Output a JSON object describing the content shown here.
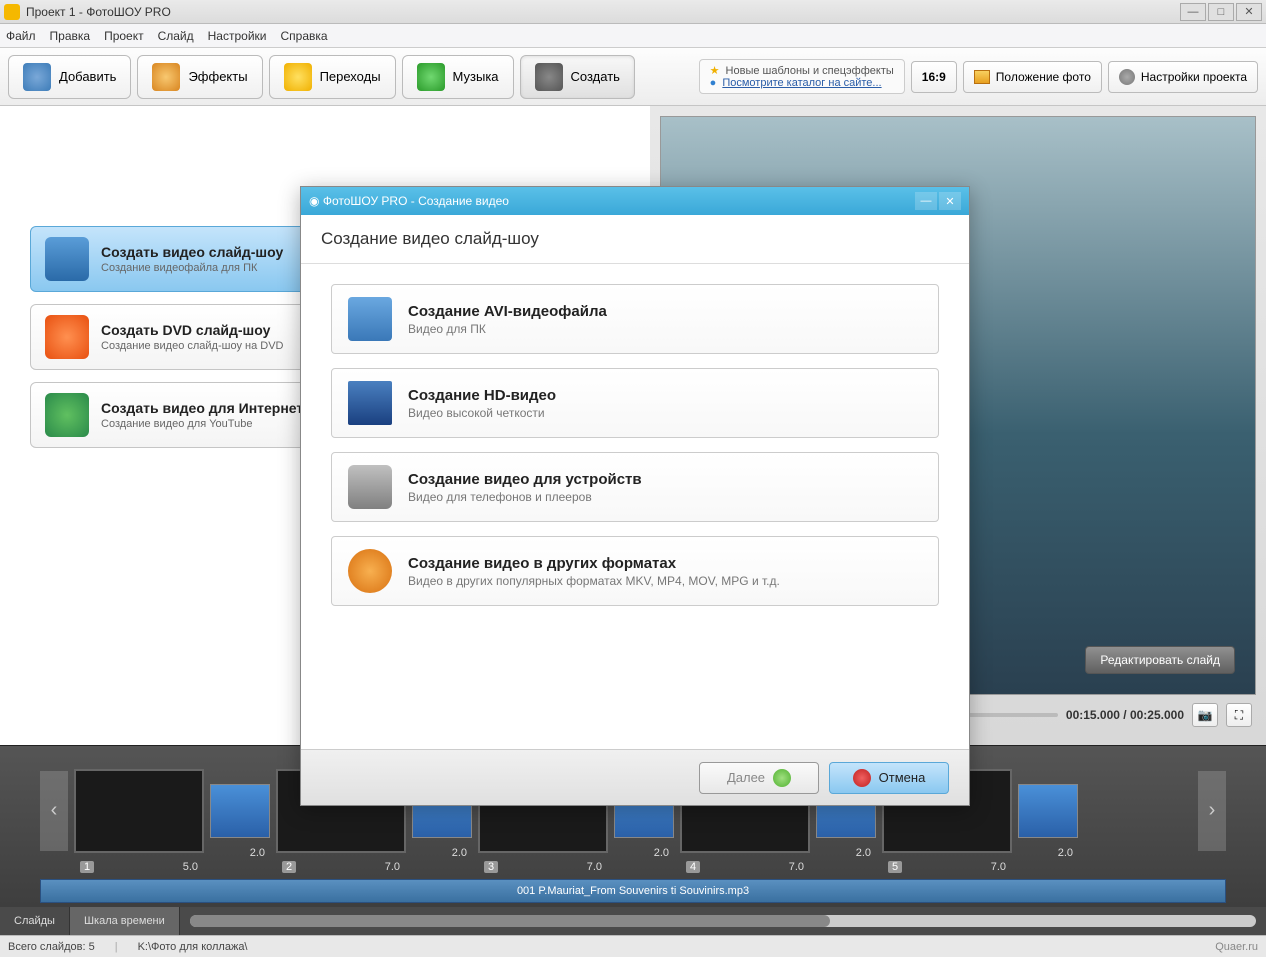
{
  "window": {
    "title": "Проект 1 - ФотоШОУ PRO"
  },
  "menu": [
    "Файл",
    "Правка",
    "Проект",
    "Слайд",
    "Настройки",
    "Справка"
  ],
  "tabs": {
    "add": "Добавить",
    "effects": "Эффекты",
    "transitions": "Переходы",
    "music": "Музыка",
    "create": "Создать"
  },
  "promo": {
    "line1": "Новые шаблоны и спецэффекты",
    "line2": "Посмотрите каталог на сайте..."
  },
  "tools": {
    "ratio": "16:9",
    "photo_pos": "Положение фото",
    "proj_settings": "Настройки проекта"
  },
  "left_options": [
    {
      "title": "Создать видео слайд-шоу",
      "sub": "Создание видеофайла для ПК"
    },
    {
      "title": "Создать DVD слайд-шоу",
      "sub": "Создание видео слайд-шоу на DVD"
    },
    {
      "title": "Создать видео для Интернет",
      "sub": "Создание видео для YouTube"
    }
  ],
  "preview": {
    "edit_btn": "Редактировать слайд",
    "timecode": "00:15.000 / 00:25.000"
  },
  "timeline": {
    "slides": [
      {
        "num": "1",
        "dur": "5.0"
      },
      {
        "num": "2",
        "dur": "7.0"
      },
      {
        "num": "3",
        "dur": "7.0"
      },
      {
        "num": "4",
        "dur": "7.0"
      },
      {
        "num": "5",
        "dur": "7.0"
      }
    ],
    "trans_dur": "2.0",
    "audio": "001 P.Mauriat_From Souvenirs ti Souvinirs.mp3",
    "tab_slides": "Слайды",
    "tab_timeline": "Шкала времени"
  },
  "status": {
    "count_label": "Всего слайдов: 5",
    "path": "K:\\Фото для коллажа\\",
    "brand": "Quaer.ru"
  },
  "modal": {
    "title": "ФотоШОУ PRO - Создание видео",
    "header": "Создание видео слайд-шоу",
    "options": [
      {
        "title": "Создание AVI-видеофайла",
        "sub": "Видео для ПК"
      },
      {
        "title": "Создание HD-видео",
        "sub": "Видео высокой четкости"
      },
      {
        "title": "Создание видео для устройств",
        "sub": "Видео для телефонов и плееров"
      },
      {
        "title": "Создание видео в других форматах",
        "sub": "Видео в других популярных форматах MKV, MP4, MOV, MPG и т.д."
      }
    ],
    "next": "Далее",
    "cancel": "Отмена"
  }
}
